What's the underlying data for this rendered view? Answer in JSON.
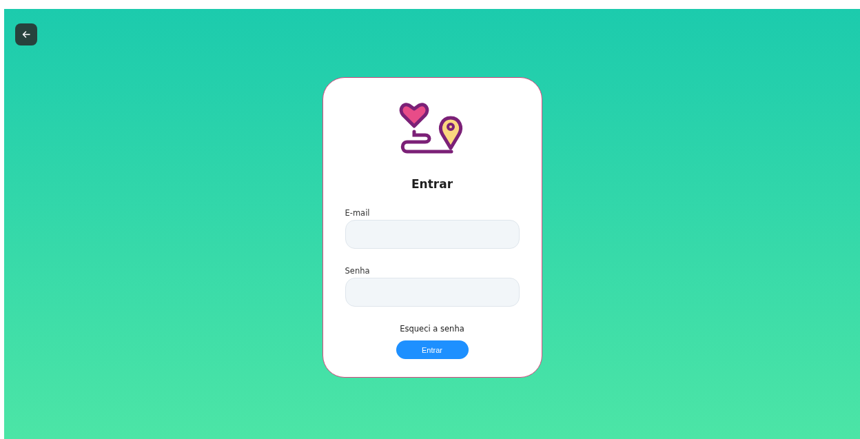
{
  "title": "Entrar",
  "fields": [
    {
      "label": "E-mail"
    },
    {
      "label": "Senha"
    }
  ],
  "forgot_link": "Esqueci a senha",
  "submit_button": "Entrar"
}
